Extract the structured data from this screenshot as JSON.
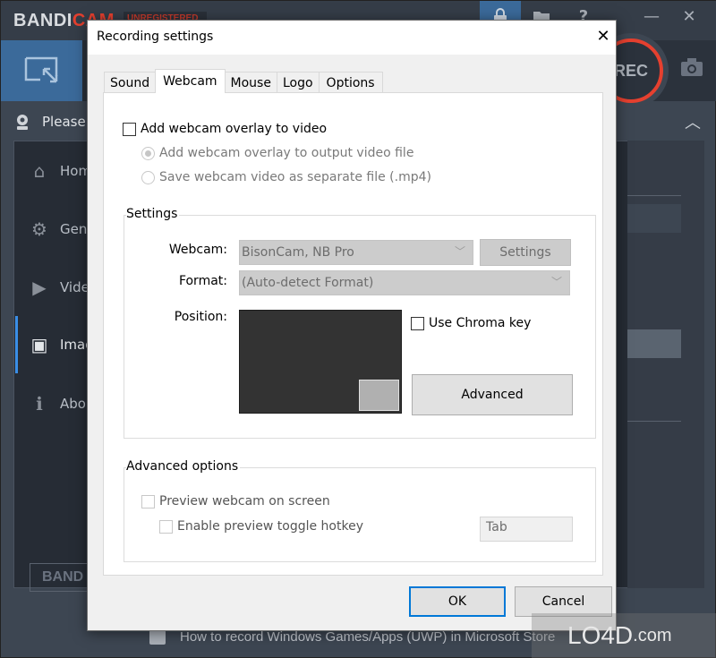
{
  "app": {
    "brand_main": "BANDI",
    "brand_accent": "CAM",
    "unregistered_badge": "UNREGISTERED",
    "titlebar_icons": [
      "lock-icon",
      "folder-icon",
      "help-icon",
      "minimize-icon",
      "close-icon"
    ],
    "help_glyph": "?",
    "minimize_glyph": "—",
    "close_glyph": "✕",
    "rec_label": "REC",
    "status_text": "Please s",
    "nav": [
      {
        "label": "Home",
        "icon": "home-icon",
        "glyph": "⌂"
      },
      {
        "label": "General",
        "icon": "gear-icon",
        "glyph": "⚙"
      },
      {
        "label": "Video",
        "icon": "video-settings-icon",
        "glyph": "▶"
      },
      {
        "label": "Image",
        "icon": "image-settings-icon",
        "glyph": "▣",
        "active": true
      },
      {
        "label": "About",
        "icon": "info-icon",
        "glyph": "ℹ"
      }
    ],
    "bandi_logo_text": "BAND",
    "bottom_tip": "How to record Windows Games/Apps (UWP) in Microsoft Store",
    "watermark": "LO4D",
    "watermark_suffix": ".com",
    "colors": {
      "accent_red": "#e5402f",
      "accent_blue": "#3b6a9a",
      "nav_indicator": "#3a8ee6"
    }
  },
  "dialog": {
    "title": "Recording settings",
    "close_glyph": "✕",
    "tabs": [
      {
        "label": "Sound",
        "active": false
      },
      {
        "label": "Webcam",
        "active": true
      },
      {
        "label": "Mouse",
        "active": false
      },
      {
        "label": "Logo",
        "active": false
      },
      {
        "label": "Options",
        "active": false
      }
    ],
    "webcam": {
      "add_overlay": {
        "label": "Add webcam overlay to video",
        "checked": false
      },
      "radio_overlay": {
        "label": "Add webcam overlay to output video file",
        "selected": true,
        "enabled": false
      },
      "radio_separate": {
        "label": "Save webcam video as separate file (.mp4)",
        "selected": false,
        "enabled": false
      },
      "settings_group": {
        "title": "Settings",
        "webcam_label": "Webcam:",
        "webcam_value": "BisonCam, NB Pro",
        "settings_button": "Settings",
        "format_label": "Format:",
        "format_value": "(Auto-detect Format)",
        "position_label": "Position:",
        "chroma_key": {
          "label": "Use Chroma key",
          "checked": false
        },
        "advanced_button": "Advanced"
      },
      "advanced_group": {
        "title": "Advanced options",
        "preview_on_screen": {
          "label": "Preview webcam on screen",
          "checked": false,
          "enabled": false
        },
        "enable_hotkey": {
          "label": "Enable preview toggle hotkey",
          "checked": false,
          "enabled": false
        },
        "hotkey_value": "Tab"
      }
    },
    "ok_label": "OK",
    "cancel_label": "Cancel"
  }
}
